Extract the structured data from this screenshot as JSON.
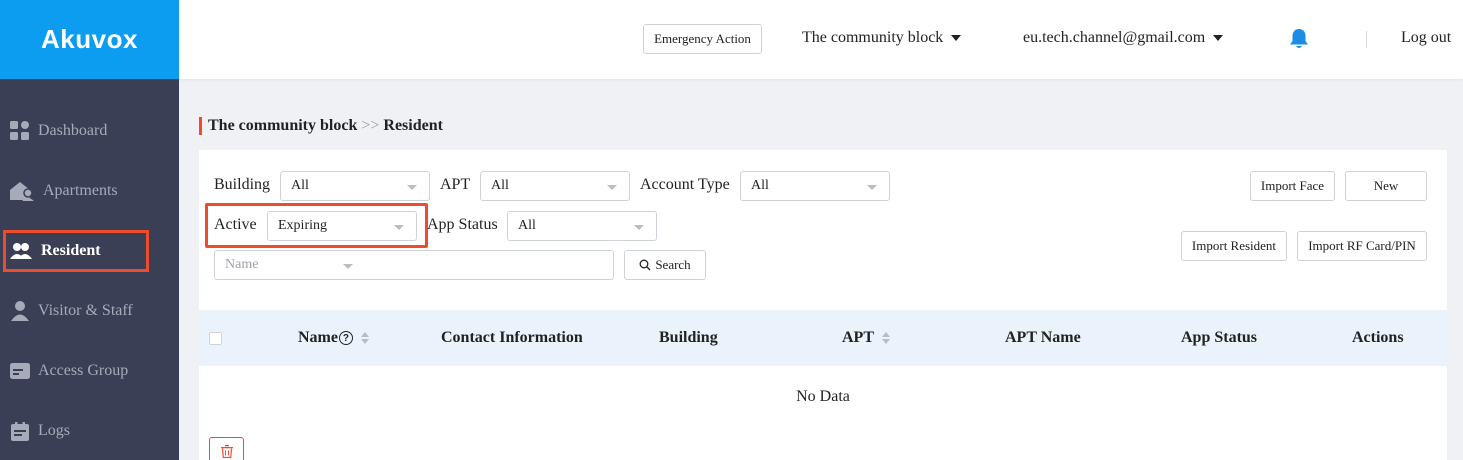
{
  "app": {
    "logo": "Akuvox",
    "brand_color": "#0d9df0",
    "accent_color": "#ee4d2d"
  },
  "header": {
    "emergency_label": "Emergency Action",
    "community": "The community block",
    "account": "eu.tech.channel@gmail.com",
    "notification_icon": "bell-icon",
    "logout_label": "Log out"
  },
  "sidebar": {
    "items": [
      {
        "label": "Dashboard",
        "icon": "dashboard-icon"
      },
      {
        "label": "Apartments",
        "icon": "apartments-icon"
      },
      {
        "label": "Resident",
        "icon": "resident-icon",
        "active": true
      },
      {
        "label": "Visitor & Staff",
        "icon": "visitor-icon"
      },
      {
        "label": "Access Group",
        "icon": "access-group-icon"
      },
      {
        "label": "Logs",
        "icon": "logs-icon"
      }
    ]
  },
  "breadcrumb": {
    "parent": "The community block",
    "separator": ">>",
    "current": "Resident"
  },
  "filters": {
    "building_label": "Building",
    "building_value": "All",
    "apt_label": "APT",
    "apt_value": "All",
    "account_type_label": "Account Type",
    "account_type_value": "All",
    "active_label": "Active",
    "active_value": "Expiring",
    "app_status_label": "App Status",
    "app_status_value": "All",
    "search_field_value": "Name",
    "search_text": "",
    "search_button": "Search"
  },
  "actions": {
    "import_face": "Import Face",
    "new": "New",
    "import_resident": "Import Resident",
    "import_rf": "Import RF Card/PIN"
  },
  "table": {
    "columns": [
      "Name",
      "Contact Information",
      "Building",
      "APT",
      "APT Name",
      "App Status",
      "Actions"
    ],
    "help_glyph": "?",
    "empty_text": "No Data"
  }
}
